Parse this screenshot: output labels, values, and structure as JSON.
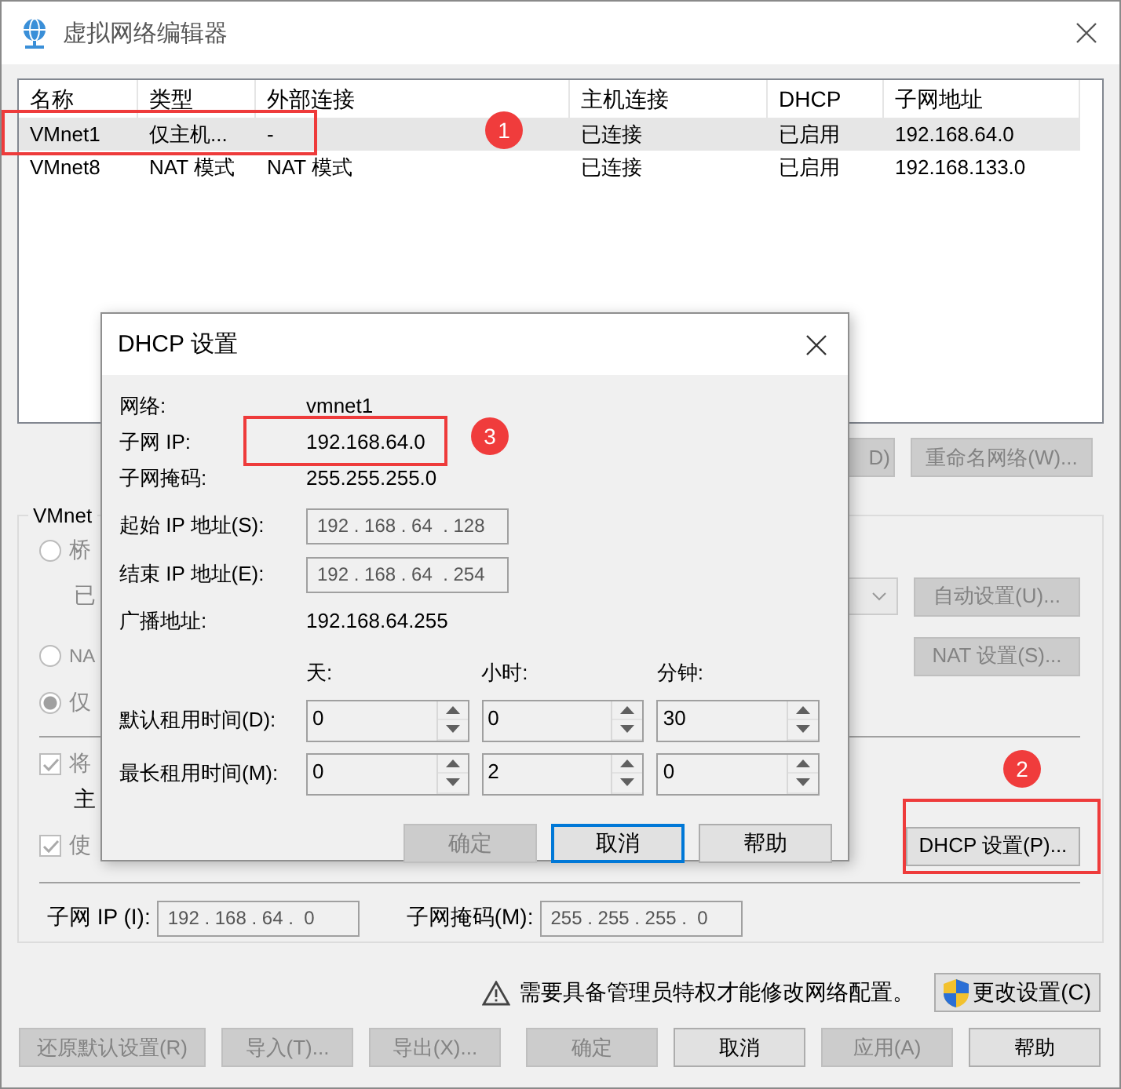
{
  "window": {
    "title": "虚拟网络编辑器"
  },
  "table": {
    "columns": [
      "名称",
      "类型",
      "外部连接",
      "主机连接",
      "DHCP",
      "子网地址"
    ],
    "rows": [
      {
        "cells": [
          "VMnet1",
          "仅主机...",
          "-",
          "已连接",
          "已启用",
          "192.168.64.0"
        ],
        "selected": true
      },
      {
        "cells": [
          "VMnet8",
          "NAT 模式",
          "NAT 模式",
          "已连接",
          "已启用",
          "192.168.133.0"
        ],
        "selected": false
      }
    ]
  },
  "table_buttons": [
    {
      "label": "D)",
      "disabled": true
    },
    {
      "label": "重命名网络(W)...",
      "disabled": true
    }
  ],
  "vmnet_group": {
    "title": "VMnet",
    "bridged_radio": {
      "label": "桥",
      "selected": false,
      "disabled": true
    },
    "bridged_to_label": "已",
    "bridged_dropdown": {
      "disabled": true
    },
    "auto_button": {
      "label": "自动设置(U)...",
      "disabled": true
    },
    "nat_radio": {
      "label": "NA",
      "selected": false,
      "disabled": true
    },
    "nat_button": {
      "label": "NAT 设置(S)...",
      "disabled": true
    },
    "host_only_radio": {
      "label": "仅",
      "selected": true,
      "disabled": true
    },
    "connect_checkbox": {
      "label": "将",
      "checked": true,
      "disabled": true
    },
    "host_adapter_label": "主",
    "dhcp_checkbox": {
      "label": "使",
      "checked": true,
      "disabled": true
    },
    "dhcp_button": {
      "label": "DHCP 设置(P)...",
      "disabled": false
    },
    "subnet_ip": {
      "label": "子网 IP (I):",
      "value": "192 . 168 . 64 .  0"
    },
    "subnet_mask": {
      "label": "子网掩码(M):",
      "value": "255 . 255 . 255 .  0"
    }
  },
  "warning": {
    "text": "需要具备管理员特权才能修改网络配置。",
    "button": "更改设置(C)"
  },
  "bottom_buttons": [
    {
      "label": "还原默认设置(R)",
      "disabled": true
    },
    {
      "label": "导入(T)...",
      "disabled": true
    },
    {
      "label": "导出(X)...",
      "disabled": true
    },
    {
      "label": "确定",
      "disabled": true
    },
    {
      "label": "取消",
      "disabled": false
    },
    {
      "label": "应用(A)",
      "disabled": true
    },
    {
      "label": "帮助",
      "disabled": false
    }
  ],
  "dhcp_dialog": {
    "title": "DHCP 设置",
    "info": [
      {
        "label": "网络:",
        "value": "vmnet1"
      },
      {
        "label": "子网 IP:",
        "value": "192.168.64.0"
      },
      {
        "label": "子网掩码:",
        "value": "255.255.255.0"
      }
    ],
    "range_fields": [
      {
        "label": "起始 IP 地址(S):",
        "value": "192 . 168 . 64  . 128"
      },
      {
        "label": "结束 IP 地址(E):",
        "value": "192 . 168 . 64  . 254"
      }
    ],
    "broadcast": {
      "label": "广播地址:",
      "value": "192.168.64.255"
    },
    "lease_units": [
      "天:",
      "小时:",
      "分钟:"
    ],
    "lease_rows": [
      {
        "label": "默认租用时间(D):",
        "values": [
          "0",
          "0",
          "30"
        ]
      },
      {
        "label": "最长租用时间(M):",
        "values": [
          "0",
          "2",
          "0"
        ]
      }
    ],
    "buttons": [
      {
        "label": "确定",
        "disabled": true,
        "focused": false
      },
      {
        "label": "取消",
        "disabled": false,
        "focused": true
      },
      {
        "label": "帮助",
        "disabled": false,
        "focused": false
      }
    ]
  },
  "annotations": [
    {
      "label": "1"
    },
    {
      "label": "2"
    },
    {
      "label": "3"
    }
  ]
}
